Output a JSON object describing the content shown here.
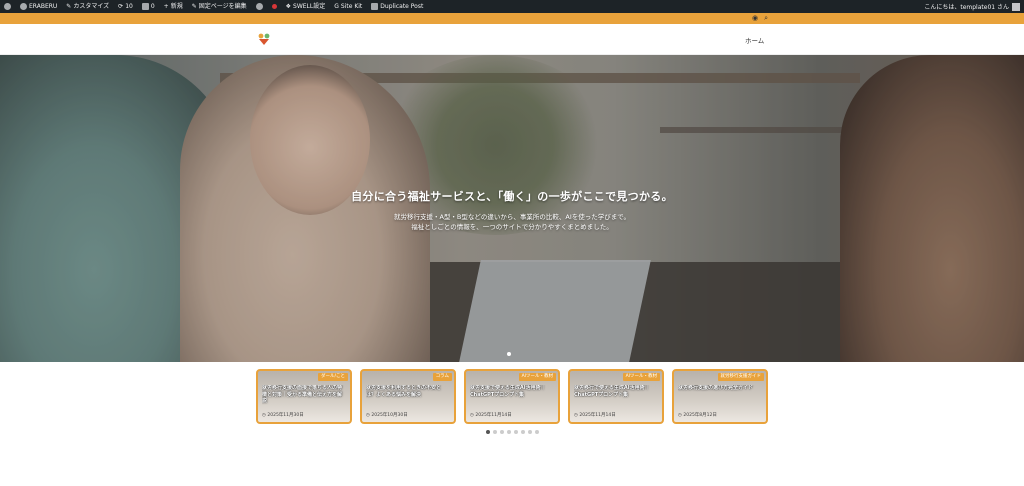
{
  "adminbar": {
    "site_name": "ERABERU",
    "customize": "カスタマイズ",
    "updates_count": "10",
    "comments_count": "0",
    "new": "新規",
    "edit_page": "固定ページを編集",
    "swell": "SWELL設定",
    "sitekit": "Site Kit",
    "duplicate": "Duplicate Post",
    "greeting": "こんにちは、template01 さん"
  },
  "header": {
    "nav_home": "ホーム"
  },
  "hero": {
    "title": "自分に合う福祉サービスと、「働く」の一歩がここで見つかる。",
    "sub1": "就労移行支援・A型・B型などの違いから、事業所の比較、AIを使った学びまで。",
    "sub2": "福祉としごとの情報を、一つのサイトで分かりやすくまとめました。"
  },
  "posts": [
    {
      "badge": "ダール/こと",
      "title": "就労移行支援の面接で落ちる人の特徴と対策｜受かる準備と伝え方を解説",
      "date": "2025年11月30日"
    },
    {
      "badge": "コラム",
      "title": "就労支援を利用するときの不安とは？よくある悩みを解決",
      "date": "2025年10月30日"
    },
    {
      "badge": "AIツール・教材",
      "title": "就労支援で使える生成AI活用術｜ChatGPTプロンプト集",
      "date": "2025年11月14日"
    },
    {
      "badge": "AIツール・教材",
      "title": "就労移行で使える生成AI活用術｜ChatGPTプロンプト集",
      "date": "2025年11月14日"
    },
    {
      "badge": "就労移行支援ガイド",
      "title": "就労移行支援の選び方完全ガイド",
      "date": "2025年8月12日"
    }
  ],
  "colors": {
    "accent": "#e8a23b",
    "adminbar": "#1d2327"
  }
}
